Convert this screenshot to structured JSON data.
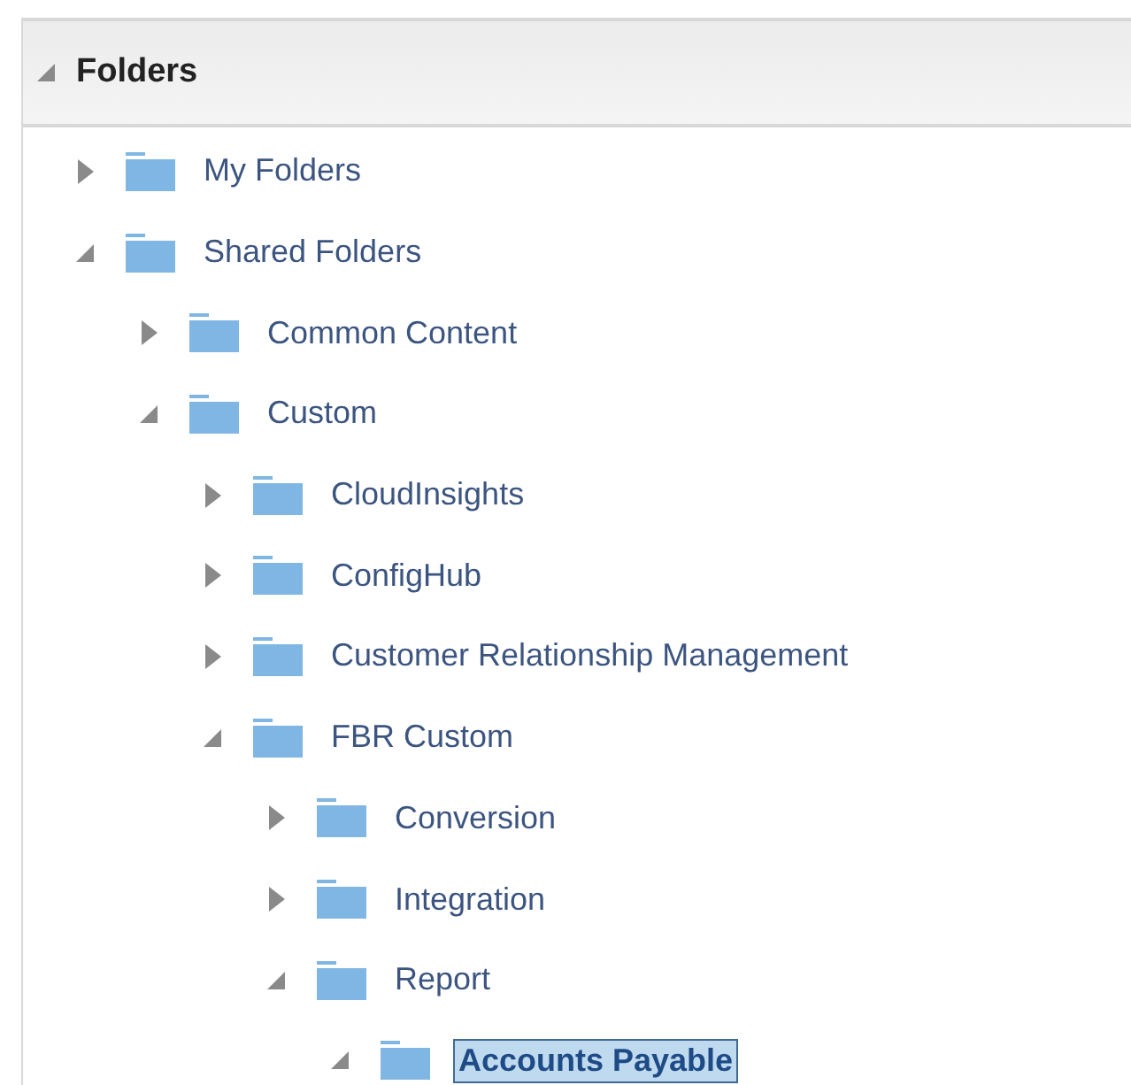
{
  "panel": {
    "title": "Folders",
    "expanded": true
  },
  "tree": [
    {
      "label": "My Folders",
      "expanded": false,
      "selected": false
    },
    {
      "label": "Shared Folders",
      "expanded": true,
      "selected": false,
      "children": [
        {
          "label": "Common Content",
          "expanded": false,
          "selected": false
        },
        {
          "label": "Custom",
          "expanded": true,
          "selected": false,
          "children": [
            {
              "label": "CloudInsights",
              "expanded": false,
              "selected": false
            },
            {
              "label": "ConfigHub",
              "expanded": false,
              "selected": false
            },
            {
              "label": "Customer Relationship Management",
              "expanded": false,
              "selected": false
            },
            {
              "label": "FBR Custom",
              "expanded": true,
              "selected": false,
              "children": [
                {
                  "label": "Conversion",
                  "expanded": false,
                  "selected": false
                },
                {
                  "label": "Integration",
                  "expanded": false,
                  "selected": false
                },
                {
                  "label": "Report",
                  "expanded": true,
                  "selected": false,
                  "children": [
                    {
                      "label": "Accounts Payable",
                      "expanded": true,
                      "selected": true
                    }
                  ]
                }
              ]
            }
          ]
        }
      ]
    }
  ]
}
